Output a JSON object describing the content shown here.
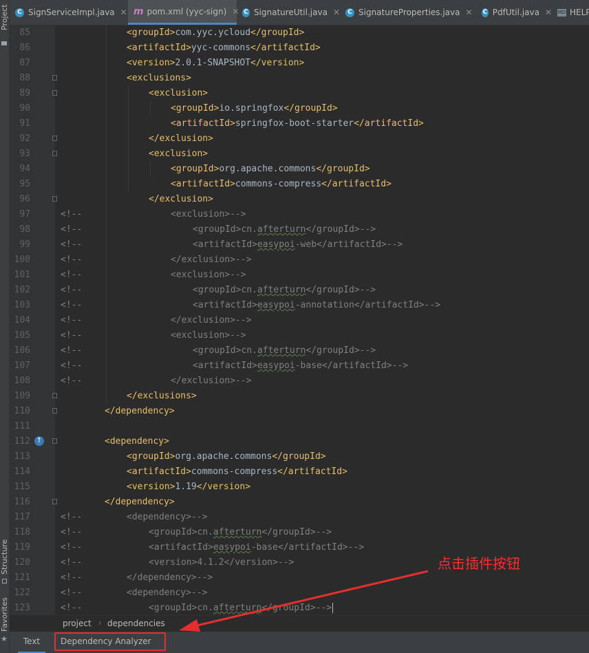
{
  "left_panel": {
    "project_label": "Project",
    "structure_label": "Structure",
    "favorites_label": "Favorites"
  },
  "tabs": [
    {
      "label": "SignServiceImpl.java",
      "icon": "class-icon"
    },
    {
      "label": "pom.xml (yyc-sign)",
      "icon": "maven-icon",
      "active": true
    },
    {
      "label": "SignatureUtil.java",
      "icon": "class-icon"
    },
    {
      "label": "SignatureProperties.java",
      "icon": "class-icon"
    },
    {
      "label": "PdfUtil.java",
      "icon": "class-icon"
    },
    {
      "label": "HELP",
      "icon": "markdown-icon"
    }
  ],
  "lines": [
    {
      "n": "85",
      "i": 3,
      "code": "<groupId>com.yyc.ycloud</groupId>"
    },
    {
      "n": "86",
      "i": 3,
      "code": "<artifactId>yyc-commons</artifactId>"
    },
    {
      "n": "87",
      "i": 3,
      "code": "<version>2.0.1-SNAPSHOT</version>"
    },
    {
      "n": "88",
      "i": 3,
      "code": "<exclusions>"
    },
    {
      "n": "89",
      "i": 4,
      "code": "<exclusion>"
    },
    {
      "n": "90",
      "i": 5,
      "code": "<groupId>io.springfox</groupId>"
    },
    {
      "n": "91",
      "i": 5,
      "code": "<artifactId>springfox-boot-starter</artifactId>"
    },
    {
      "n": "92",
      "i": 4,
      "code": "</exclusion>"
    },
    {
      "n": "93",
      "i": 4,
      "code": "<exclusion>"
    },
    {
      "n": "94",
      "i": 5,
      "code": "<groupId>org.apache.commons</groupId>"
    },
    {
      "n": "95",
      "i": 5,
      "code": "<artifactId>commons-compress</artifactId>"
    },
    {
      "n": "96",
      "i": 4,
      "code": "</exclusion>"
    },
    {
      "n": "97",
      "i": 5,
      "code": "<exclusion>-->",
      "comment": true
    },
    {
      "n": "98",
      "i": 6,
      "code": "<groupId>cn.afterturn</groupId>-->",
      "comment": true
    },
    {
      "n": "99",
      "i": 6,
      "code": "<artifactId>easypoi-web</artifactId>-->",
      "comment": true
    },
    {
      "n": "100",
      "i": 5,
      "code": "</exclusion>-->",
      "comment": true
    },
    {
      "n": "101",
      "i": 5,
      "code": "<exclusion>-->",
      "comment": true
    },
    {
      "n": "102",
      "i": 6,
      "code": "<groupId>cn.afterturn</groupId>-->",
      "comment": true
    },
    {
      "n": "103",
      "i": 6,
      "code": "<artifactId>easypoi-annotation</artifactId>-->",
      "comment": true
    },
    {
      "n": "104",
      "i": 5,
      "code": "</exclusion>-->",
      "comment": true
    },
    {
      "n": "105",
      "i": 5,
      "code": "<exclusion>-->",
      "comment": true
    },
    {
      "n": "106",
      "i": 6,
      "code": "<groupId>cn.afterturn</groupId>-->",
      "comment": true
    },
    {
      "n": "107",
      "i": 6,
      "code": "<artifactId>easypoi-base</artifactId>-->",
      "comment": true
    },
    {
      "n": "108",
      "i": 5,
      "code": "</exclusion>-->",
      "comment": true
    },
    {
      "n": "109",
      "i": 3,
      "code": "</exclusions>"
    },
    {
      "n": "110",
      "i": 2,
      "code": "</dependency>"
    },
    {
      "n": "111",
      "i": 0,
      "code": ""
    },
    {
      "n": "112",
      "i": 2,
      "code": "<dependency>"
    },
    {
      "n": "113",
      "i": 3,
      "code": "<groupId>org.apache.commons</groupId>"
    },
    {
      "n": "114",
      "i": 3,
      "code": "<artifactId>commons-compress</artifactId>"
    },
    {
      "n": "115",
      "i": 3,
      "code": "<version>1.19</version>"
    },
    {
      "n": "116",
      "i": 2,
      "code": "</dependency>"
    },
    {
      "n": "117",
      "i": 3,
      "code": "<dependency>-->",
      "comment": true
    },
    {
      "n": "118",
      "i": 4,
      "code": "<groupId>cn.afterturn</groupId>-->",
      "comment": true
    },
    {
      "n": "119",
      "i": 4,
      "code": "<artifactId>easypoi-base</artifactId>-->",
      "comment": true
    },
    {
      "n": "120",
      "i": 4,
      "code": "<version>4.1.2</version>-->",
      "comment": true
    },
    {
      "n": "121",
      "i": 3,
      "code": "</dependency>-->",
      "comment": true
    },
    {
      "n": "122",
      "i": 3,
      "code": "<dependency>-->",
      "comment": true
    },
    {
      "n": "123",
      "i": 4,
      "code": "<groupId>cn.afterturn</groupId>-->",
      "comment": true,
      "caret": true
    }
  ],
  "breadcrumb": [
    "project",
    "dependencies"
  ],
  "bottom_tabs": [
    {
      "label": "Text",
      "active": true
    },
    {
      "label": "Dependency Analyzer"
    }
  ],
  "annotation": "点击插件按钮",
  "colors": {
    "annotation": "#ff2d2d",
    "tag": "#e8bf6a",
    "comment": "#808080",
    "background": "#2b2b2b"
  }
}
